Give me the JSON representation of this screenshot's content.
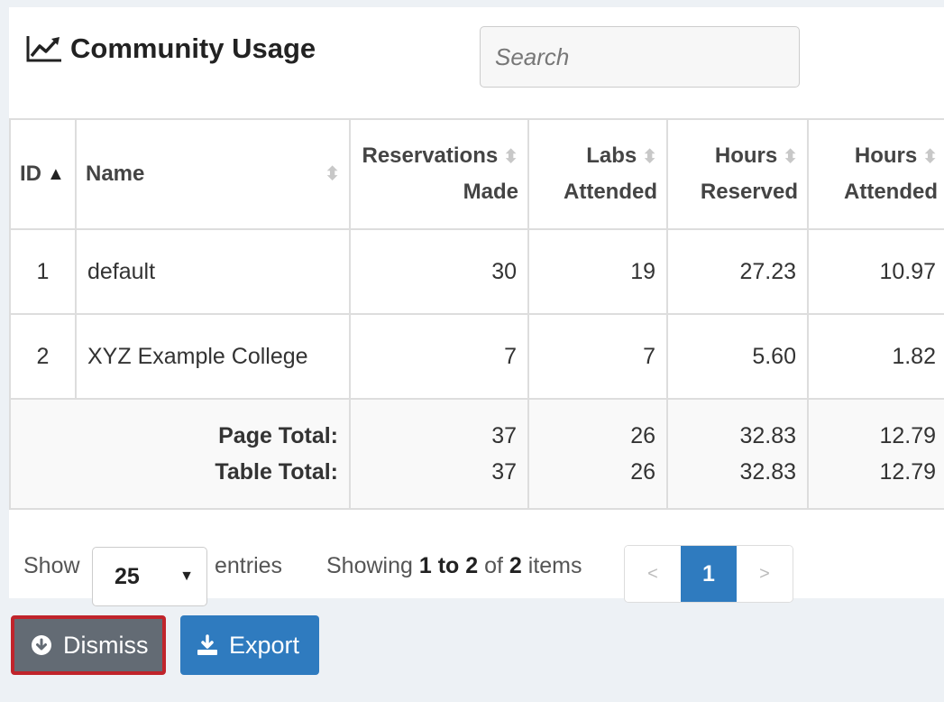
{
  "title": "Community Usage",
  "search": {
    "placeholder": "Search"
  },
  "table": {
    "columns": [
      {
        "label1": "ID",
        "label2": "",
        "sort": "asc"
      },
      {
        "label1": "Name",
        "label2": "",
        "sort": "none"
      },
      {
        "label1": "Reservations",
        "label2": "Made",
        "sort": "none"
      },
      {
        "label1": "Labs",
        "label2": "Attended",
        "sort": "none"
      },
      {
        "label1": "Hours",
        "label2": "Reserved",
        "sort": "none"
      },
      {
        "label1": "Hours",
        "label2": "Attended",
        "sort": "none"
      }
    ],
    "rows": [
      {
        "id": "1",
        "name": "default",
        "reservations": "30",
        "labs": "19",
        "hours_reserved": "27.23",
        "hours_attended": "10.97"
      },
      {
        "id": "2",
        "name": "XYZ Example College",
        "reservations": "7",
        "labs": "7",
        "hours_reserved": "5.60",
        "hours_attended": "1.82"
      }
    ],
    "footer": {
      "page_total_label": "Page Total:",
      "table_total_label": "Table Total:",
      "page_total": {
        "reservations": "37",
        "labs": "26",
        "hours_reserved": "32.83",
        "hours_attended": "12.79"
      },
      "table_total": {
        "reservations": "37",
        "labs": "26",
        "hours_reserved": "32.83",
        "hours_attended": "12.79"
      }
    }
  },
  "pagination": {
    "show_label": "Show",
    "page_size": "25",
    "entries_label": "entries",
    "showing_prefix": "Showing",
    "range": "1 to 2",
    "of_label": "of",
    "total": "2",
    "items_label": "items",
    "prev": "<",
    "current_page": "1",
    "next": ">"
  },
  "buttons": {
    "dismiss": "Dismiss",
    "export": "Export"
  },
  "colors": {
    "primary": "#2f7bbf",
    "dismiss_bg": "#636b74",
    "dismiss_border": "#c0242b"
  }
}
